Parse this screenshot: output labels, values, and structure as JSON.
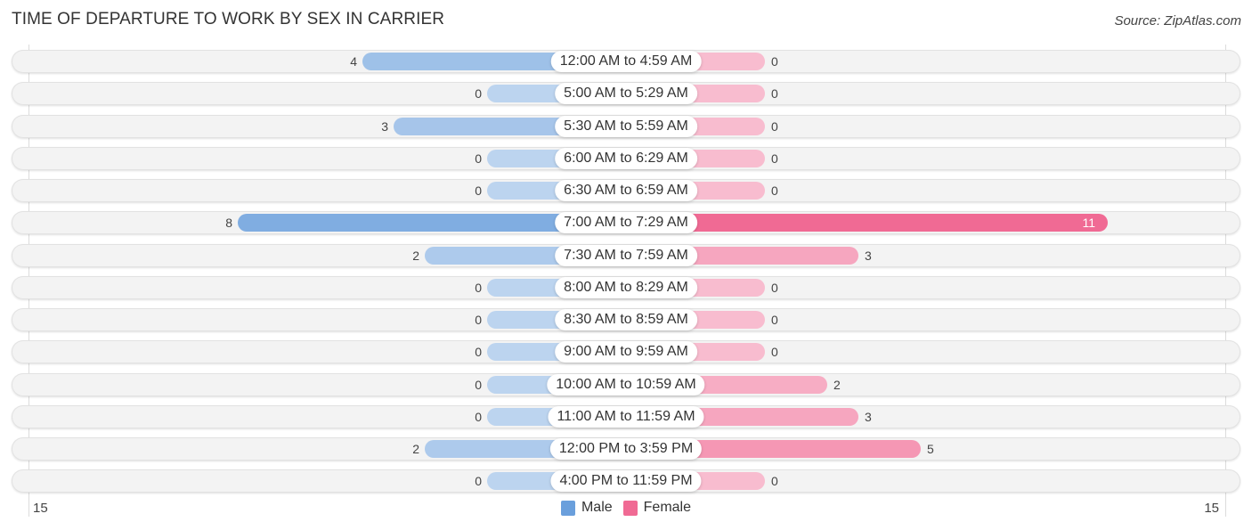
{
  "chart_data": {
    "type": "bar",
    "orientation": "horizontal-diverging",
    "title": "TIME OF DEPARTURE TO WORK BY SEX IN CARRIER",
    "source": "Source: ZipAtlas.com",
    "categories": [
      "12:00 AM to 4:59 AM",
      "5:00 AM to 5:29 AM",
      "5:30 AM to 5:59 AM",
      "6:00 AM to 6:29 AM",
      "6:30 AM to 6:59 AM",
      "7:00 AM to 7:29 AM",
      "7:30 AM to 7:59 AM",
      "8:00 AM to 8:29 AM",
      "8:30 AM to 8:59 AM",
      "9:00 AM to 9:59 AM",
      "10:00 AM to 10:59 AM",
      "11:00 AM to 11:59 AM",
      "12:00 PM to 3:59 PM",
      "4:00 PM to 11:59 PM"
    ],
    "series": [
      {
        "name": "Male",
        "color": "#6a9fdc",
        "values": [
          4,
          0,
          3,
          0,
          0,
          8,
          2,
          0,
          0,
          0,
          0,
          0,
          2,
          0
        ]
      },
      {
        "name": "Female",
        "color": "#f06a94",
        "values": [
          0,
          0,
          0,
          0,
          0,
          11,
          3,
          0,
          0,
          0,
          2,
          3,
          5,
          0
        ]
      }
    ],
    "axis": {
      "left_label": "15",
      "right_label": "15",
      "range": [
        0,
        15
      ]
    },
    "legend": {
      "position": "bottom-center",
      "items": [
        "Male",
        "Female"
      ]
    },
    "grid": false
  }
}
